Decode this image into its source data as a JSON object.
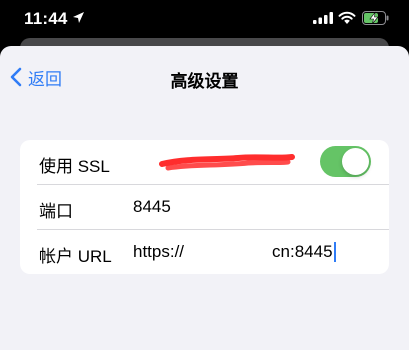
{
  "status_bar": {
    "time": "11:44",
    "icons": [
      "location-arrow-icon",
      "cellular-signal-icon",
      "wifi-icon",
      "battery-charging-icon"
    ]
  },
  "nav": {
    "back_label": "返回",
    "title": "高级设置"
  },
  "settings": {
    "ssl_label": "使用 SSL",
    "ssl_enabled": true,
    "port_label": "端口",
    "port_value": "8445",
    "account_url_label": "帐户 URL",
    "account_url_value": "https://",
    "account_url_tail": "cn:8445"
  },
  "colors": {
    "accent": "#2f7cf6",
    "toggle_on": "#65c466",
    "sheet_background": "#f2f2f7",
    "redaction": "#ff2d2d"
  }
}
